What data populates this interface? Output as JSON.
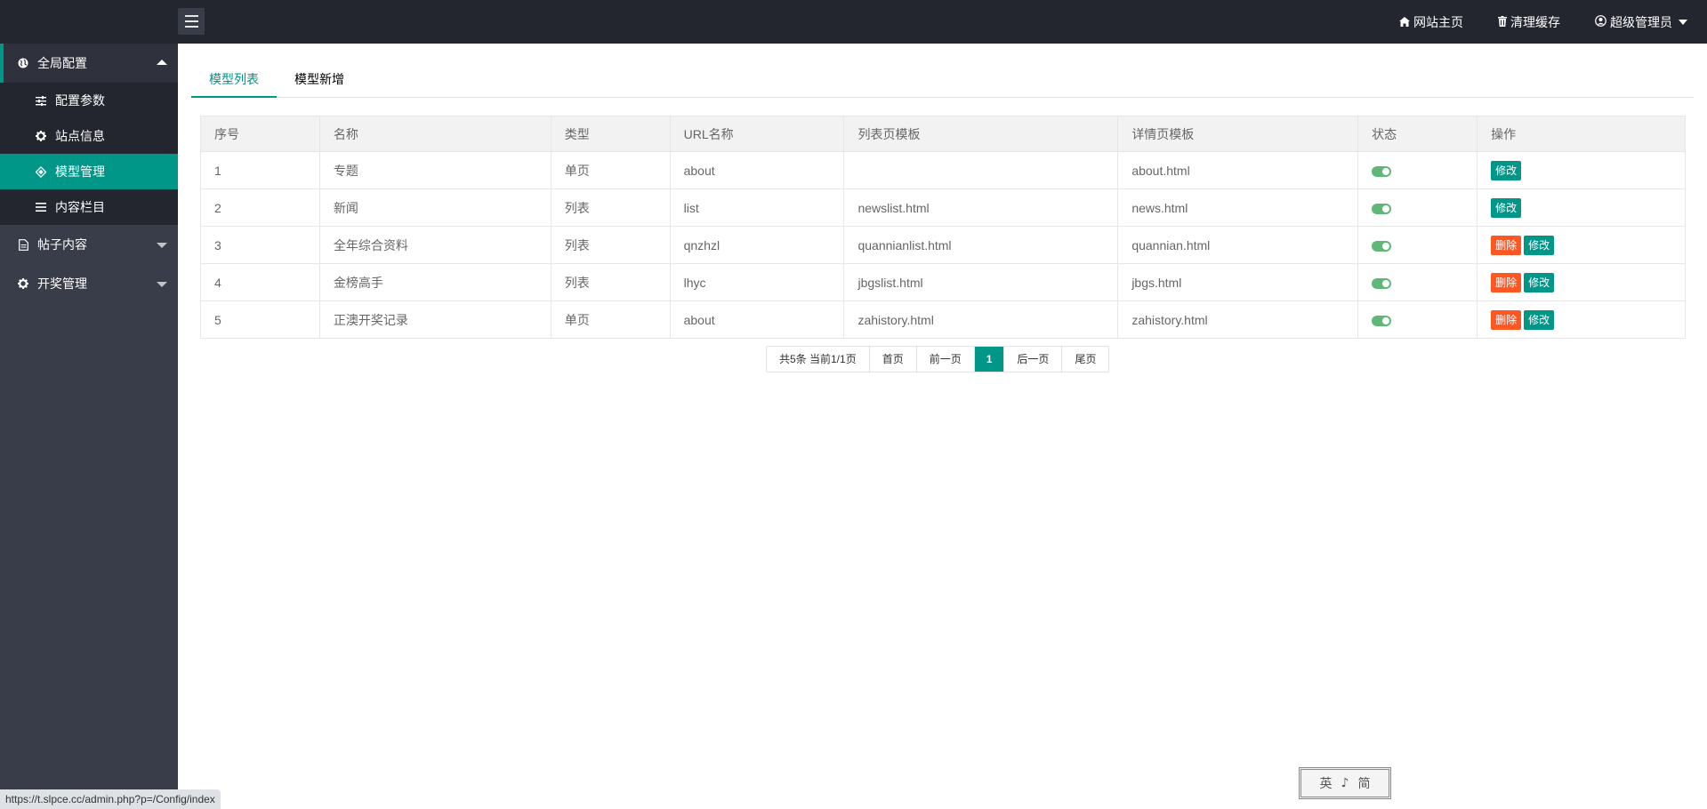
{
  "header": {
    "nav": [
      {
        "icon": "home-icon",
        "label": "网站主页"
      },
      {
        "icon": "trash-icon",
        "label": "清理缓存"
      },
      {
        "icon": "user-circle-icon",
        "label": "超级管理员"
      }
    ]
  },
  "sidebar": {
    "groups": [
      {
        "label": "全局配置",
        "icon": "globe-icon",
        "expanded": true,
        "items": [
          {
            "label": "配置参数",
            "icon": "sliders-icon"
          },
          {
            "label": "站点信息",
            "icon": "gear-icon"
          },
          {
            "label": "模型管理",
            "icon": "cube-icon",
            "active": true
          },
          {
            "label": "内容栏目",
            "icon": "list-icon"
          }
        ]
      },
      {
        "label": "帖子内容",
        "icon": "document-icon",
        "expanded": false
      },
      {
        "label": "开奖管理",
        "icon": "gear-icon",
        "expanded": false
      }
    ]
  },
  "tabs": [
    {
      "label": "模型列表",
      "active": true
    },
    {
      "label": "模型新增",
      "active": false
    }
  ],
  "table": {
    "columns": [
      "序号",
      "名称",
      "类型",
      "URL名称",
      "列表页模板",
      "详情页模板",
      "状态",
      "操作"
    ],
    "rows": [
      {
        "id": "1",
        "name": "专题",
        "type": "单页",
        "url": "about",
        "list_tpl": "",
        "detail_tpl": "about.html",
        "status": true,
        "can_delete": false
      },
      {
        "id": "2",
        "name": "新闻",
        "type": "列表",
        "url": "list",
        "list_tpl": "newslist.html",
        "detail_tpl": "news.html",
        "status": true,
        "can_delete": false
      },
      {
        "id": "3",
        "name": "全年综合资料",
        "type": "列表",
        "url": "qnzhzl",
        "list_tpl": "quannianlist.html",
        "detail_tpl": "quannian.html",
        "status": true,
        "can_delete": true
      },
      {
        "id": "4",
        "name": "金榜高手",
        "type": "列表",
        "url": "lhyc",
        "list_tpl": "jbgslist.html",
        "detail_tpl": "jbgs.html",
        "status": true,
        "can_delete": true
      },
      {
        "id": "5",
        "name": "正澳开奖记录",
        "type": "单页",
        "url": "about",
        "list_tpl": "zahistory.html",
        "detail_tpl": "zahistory.html",
        "status": true,
        "can_delete": true
      }
    ],
    "actions": {
      "delete_label": "删除",
      "edit_label": "修改"
    }
  },
  "pager": {
    "info": "共5条 当前1/1页",
    "first": "首页",
    "prev": "前一页",
    "current": "1",
    "next": "后一页",
    "last": "尾页"
  },
  "statusbar": {
    "url": "https://t.slpce.cc/admin.php?p=/Config/index"
  },
  "stamp": {
    "chars": [
      "英",
      "♪",
      "简"
    ]
  },
  "colors": {
    "accent": "#009688",
    "danger": "#ff5722",
    "header_bg": "#23262e",
    "sidebar_bg": "#393d49",
    "switch_on": "#5fb878"
  }
}
